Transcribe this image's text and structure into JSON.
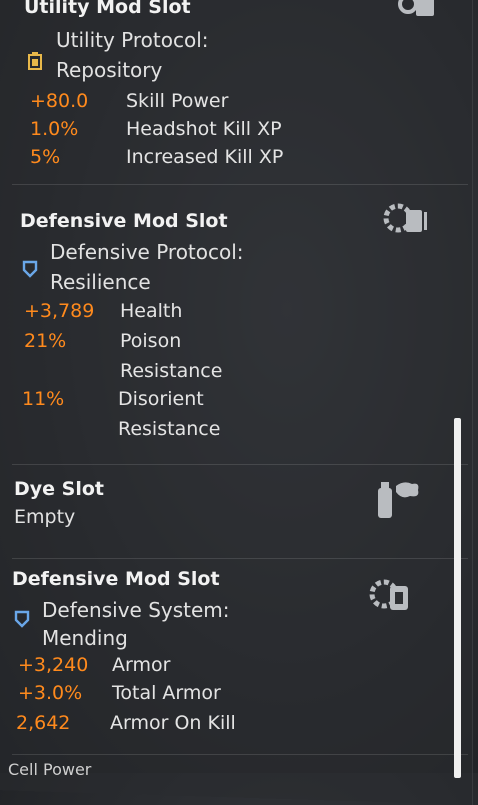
{
  "sections": [
    {
      "title": "Utility Mod Slot",
      "protocol_line1": "Utility Protocol:",
      "protocol_line2": "Repository",
      "stats": [
        {
          "value": "+80.0",
          "name": "Skill Power"
        },
        {
          "value": "1.0%",
          "name": "Headshot Kill XP"
        },
        {
          "value": "5%",
          "name": "Increased Kill XP"
        }
      ]
    },
    {
      "title": "Defensive Mod Slot",
      "protocol_line1": "Defensive Protocol:",
      "protocol_line2": "Resilience",
      "stats": [
        {
          "value": "+3,789",
          "name": "Health",
          "name2": ""
        },
        {
          "value": "21%",
          "name": "Poison",
          "name2": "Resistance"
        },
        {
          "value": "11%",
          "name": "Disorient",
          "name2": "Resistance"
        }
      ]
    },
    {
      "title": "Dye Slot",
      "subtitle": "Empty"
    },
    {
      "title": "Defensive Mod Slot",
      "protocol_line1": "Defensive System:",
      "protocol_line2": "Mending",
      "stats": [
        {
          "value": "+3,240",
          "name": "Armor"
        },
        {
          "value": "+3.0%",
          "name": "Total Armor"
        },
        {
          "value": "2,642",
          "name": "Armor On Kill"
        }
      ]
    }
  ],
  "bottom_partial": "Cell Power",
  "colors": {
    "stat_value": "#ff8a1d",
    "utility_icon": "#e8b84a",
    "defensive_icon": "#6aa7e8"
  },
  "icons": [
    "utility-mod-icon",
    "defensive-mod-icon",
    "dye-spray-icon",
    "defensive-system-mod-icon"
  ]
}
